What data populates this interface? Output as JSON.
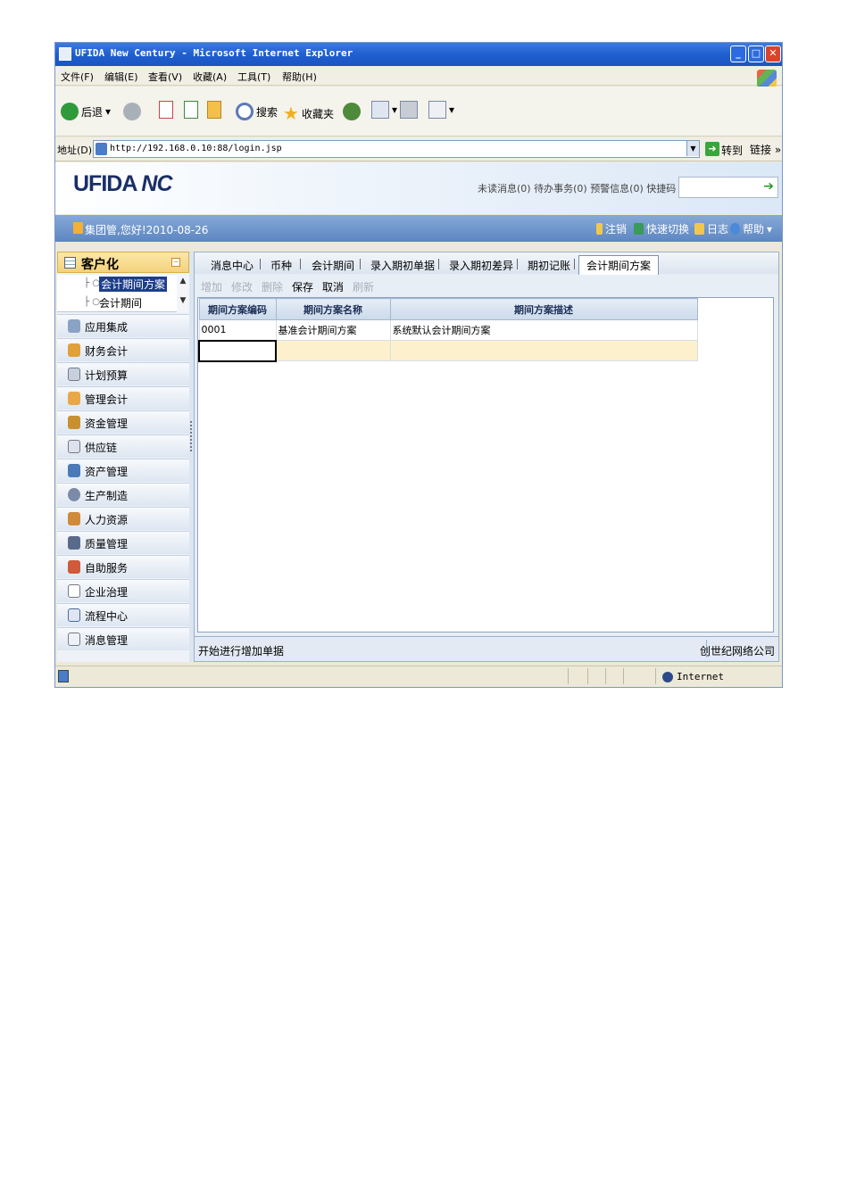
{
  "window": {
    "title": "UFIDA New Century - Microsoft Internet Explorer"
  },
  "ie_menu": [
    "文件(F)",
    "编辑(E)",
    "查看(V)",
    "收藏(A)",
    "工具(T)",
    "帮助(H)"
  ],
  "ie_toolbar": {
    "back": "后退",
    "search": "搜索",
    "favorites": "收藏夹"
  },
  "address": {
    "label": "地址(D)",
    "url": "http://192.168.0.10:88/login.jsp",
    "go": "转到",
    "links": "链接 »"
  },
  "app_header": {
    "logo_text": "UFIDA",
    "logo_nc": "NC",
    "unread": "未读消息(0)",
    "todo": "待办事务(0)",
    "alerts": "预警信息(0)",
    "quick_code": "快捷码"
  },
  "user_bar": {
    "greeting": "集团管,您好!2010-08-26",
    "logout": "注销",
    "quick_switch": "快速切换",
    "log": "日志",
    "help": "帮助"
  },
  "sidebar": {
    "section_title": "客户化",
    "tree_nodes": [
      "会计期间方案",
      "会计期间"
    ],
    "nav_items": [
      {
        "label": "应用集成",
        "icon": "integration-icon"
      },
      {
        "label": "财务会计",
        "icon": "finance-icon"
      },
      {
        "label": "计划预算",
        "icon": "budget-icon"
      },
      {
        "label": "管理会计",
        "icon": "management-accounting-icon"
      },
      {
        "label": "资金管理",
        "icon": "fund-icon"
      },
      {
        "label": "供应链",
        "icon": "supply-chain-icon"
      },
      {
        "label": "资产管理",
        "icon": "asset-icon"
      },
      {
        "label": "生产制造",
        "icon": "manufacturing-icon"
      },
      {
        "label": "人力资源",
        "icon": "hr-icon"
      },
      {
        "label": "质量管理",
        "icon": "quality-icon"
      },
      {
        "label": "自助服务",
        "icon": "self-service-icon"
      },
      {
        "label": "企业治理",
        "icon": "governance-icon"
      },
      {
        "label": "流程中心",
        "icon": "process-icon"
      },
      {
        "label": "消息管理",
        "icon": "message-icon"
      }
    ]
  },
  "tabs": [
    "消息中心",
    "币种",
    "会计期间",
    "录入期初单据",
    "录入期初差异",
    "期初记账",
    "会计期间方案"
  ],
  "active_tab": "会计期间方案",
  "actions": {
    "add": "增加",
    "edit": "修改",
    "delete": "删除",
    "save": "保存",
    "cancel": "取消",
    "refresh": "刷新"
  },
  "grid": {
    "columns": [
      "期间方案编码",
      "期间方案名称",
      "期间方案描述"
    ],
    "rows": [
      [
        "0001",
        "基准会计期间方案",
        "系统默认会计期间方案"
      ]
    ]
  },
  "status": {
    "message": "开始进行增加单据",
    "company": "创世纪网络公司"
  },
  "ie_status": {
    "zone": "Internet"
  }
}
